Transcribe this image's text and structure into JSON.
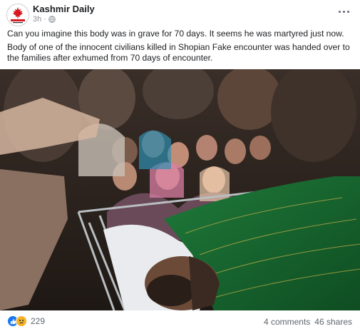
{
  "post": {
    "page_name": "Kashmir Daily",
    "time": "3h",
    "globe_icon": "globe-icon",
    "more_icon": "more-options-icon",
    "lines": [
      "Can you imagine this body was in grave for 70 days.  It seems he was martyred just now.",
      "Body of one of the innocent civilians killed in Shopian Fake encounter was handed over to the families after exhumed from 70 days of encounter."
    ],
    "photo_icon": "post-photo",
    "reactions": {
      "icons": [
        "like-icon",
        "sad-icon"
      ],
      "colors": {
        "like": "#1877f2",
        "sad": "#f7b125"
      },
      "count": "229"
    },
    "comments": "4 comments",
    "shares": "46 shares"
  }
}
